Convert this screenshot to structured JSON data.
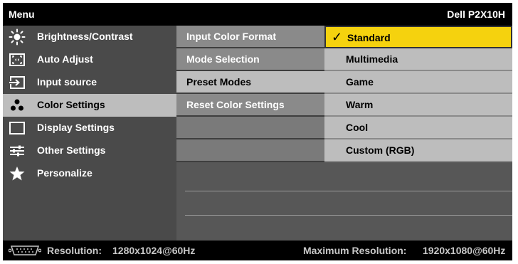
{
  "header": {
    "title": "Menu",
    "model": "Dell P2X10H"
  },
  "main_menu": {
    "items": [
      {
        "label": "Brightness/Contrast",
        "icon": "sun-icon",
        "active": false
      },
      {
        "label": "Auto Adjust",
        "icon": "auto-adjust-icon",
        "active": false
      },
      {
        "label": "Input source",
        "icon": "input-source-icon",
        "active": false
      },
      {
        "label": "Color Settings",
        "icon": "color-dots-icon",
        "active": true
      },
      {
        "label": "Display Settings",
        "icon": "display-rectangle-icon",
        "active": false
      },
      {
        "label": "Other Settings",
        "icon": "sliders-icon",
        "active": false
      },
      {
        "label": "Personalize",
        "icon": "star-icon",
        "active": false
      }
    ]
  },
  "submenu": {
    "items": [
      {
        "label": "Input Color Format",
        "active": false
      },
      {
        "label": "Mode Selection",
        "active": false
      },
      {
        "label": "Preset Modes",
        "active": true
      },
      {
        "label": "Reset Color Settings",
        "active": false
      }
    ]
  },
  "options": {
    "items": [
      {
        "label": "Standard",
        "selected": true
      },
      {
        "label": "Multimedia",
        "selected": false
      },
      {
        "label": "Game",
        "selected": false
      },
      {
        "label": "Warm",
        "selected": false
      },
      {
        "label": "Cool",
        "selected": false
      },
      {
        "label": "Custom (RGB)",
        "selected": false
      }
    ]
  },
  "footer": {
    "resolution_label": "Resolution:",
    "resolution_value": "1280x1024@60Hz",
    "max_resolution_label": "Maximum Resolution:",
    "max_resolution_value": "1920x1080@60Hz",
    "connector_icon": "vga-connector-icon"
  },
  "colors": {
    "highlight": "#f5d20e",
    "active_row": "#bdbdbd",
    "background": "#000000"
  }
}
